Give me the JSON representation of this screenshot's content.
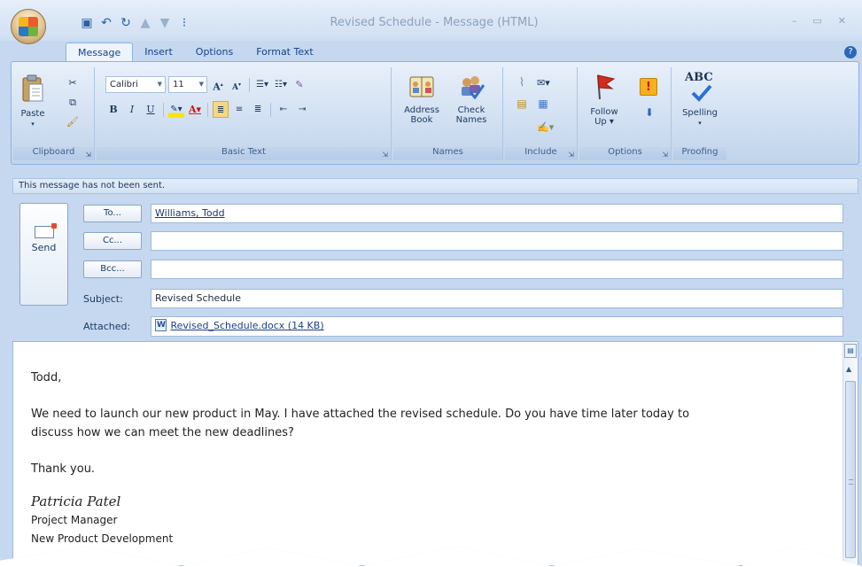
{
  "window": {
    "title": "Revised Schedule - Message (HTML)",
    "controls": [
      "–",
      "▭",
      "✕"
    ]
  },
  "quick_access": [
    "save-icon",
    "undo-icon",
    "redo-icon",
    "up-arrow-icon",
    "down-arrow-icon",
    "customize-icon"
  ],
  "tabs": [
    {
      "label": "Message",
      "active": true
    },
    {
      "label": "Insert",
      "active": false
    },
    {
      "label": "Options",
      "active": false
    },
    {
      "label": "Format Text",
      "active": false
    }
  ],
  "ribbon": {
    "clipboard": {
      "label": "Clipboard",
      "paste": "Paste"
    },
    "basic_text": {
      "label": "Basic Text",
      "font": "Calibri",
      "size": "11"
    },
    "names": {
      "label": "Names",
      "address_book": [
        "Address",
        "Book"
      ],
      "check_names": [
        "Check",
        "Names"
      ]
    },
    "include": {
      "label": "Include"
    },
    "options": {
      "label": "Options",
      "follow_up": [
        "Follow",
        "Up ▾"
      ]
    },
    "proofing": {
      "label": "Proofing",
      "spelling": "Spelling",
      "abc": "ABC"
    }
  },
  "infobar": "This message has not been sent.",
  "send": {
    "label": "Send"
  },
  "fields": {
    "to": {
      "button": "To...",
      "value": "Williams, Todd"
    },
    "cc": {
      "button": "Cc...",
      "value": ""
    },
    "bcc": {
      "button": "Bcc...",
      "value": ""
    },
    "subject": {
      "label": "Subject:",
      "value": "Revised Schedule"
    },
    "attached": {
      "label": "Attached:",
      "value": "Revised_Schedule.docx (14 KB)"
    }
  },
  "body": {
    "greeting": "Todd,",
    "paragraph_1": "We need to launch our new product in May. I have attached the revised schedule. Do you have time later today to",
    "paragraph_2": "discuss how we can meet the new deadlines?",
    "closing": "Thank you.",
    "signature": "Patricia Patel",
    "title": "Project Manager",
    "department": "New Product Development"
  },
  "colors": {
    "chrome": "#c5d8ef",
    "ribbon": "#dbe7f6",
    "accent": "#15428b",
    "flag": "#d42b1e",
    "importance": "#f5b021"
  }
}
